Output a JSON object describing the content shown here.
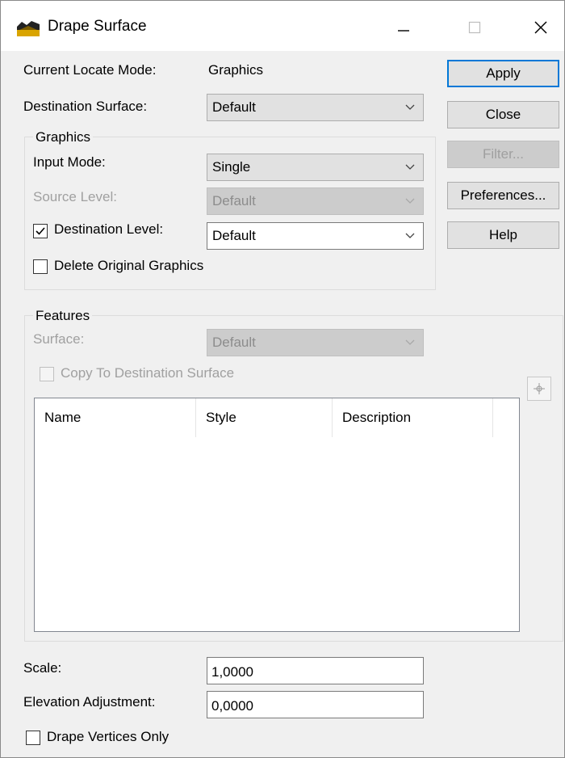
{
  "window": {
    "title": "Drape Surface",
    "icons": {
      "app": "drape-surface-app-icon",
      "minimize": "minimize-icon",
      "maximize": "maximize-icon",
      "close": "close-icon"
    }
  },
  "locate": {
    "label": "Current Locate Mode:",
    "value": "Graphics"
  },
  "destination_surface": {
    "label": "Destination Surface:",
    "value": "Default"
  },
  "buttons": {
    "apply": "Apply",
    "close": "Close",
    "filter": "Filter...",
    "preferences": "Preferences...",
    "help": "Help"
  },
  "graphics": {
    "legend": "Graphics",
    "input_mode": {
      "label": "Input Mode:",
      "value": "Single"
    },
    "source_level": {
      "label": "Source Level:",
      "value": "Default"
    },
    "destination_level": {
      "label": "Destination Level:",
      "value": "Default",
      "checked": true
    },
    "delete_original": {
      "label": "Delete Original Graphics",
      "checked": false
    }
  },
  "features": {
    "legend": "Features",
    "surface": {
      "label": "Surface:",
      "value": "Default"
    },
    "copy_to_destination": {
      "label": "Copy To Destination Surface",
      "checked": false
    },
    "table": {
      "columns": [
        "Name",
        "Style",
        "Description"
      ],
      "rows": []
    },
    "pick_icon": "crosshair-pick-icon"
  },
  "scale": {
    "label": "Scale:",
    "value": "1,0000"
  },
  "elevation": {
    "label": "Elevation Adjustment:",
    "value": "0,0000"
  },
  "drape_vertices": {
    "label": "Drape Vertices Only",
    "checked": false
  },
  "colors": {
    "accent": "#0078d7",
    "dialog_bg": "#f0f0f0",
    "disabled_text": "#a0a0a0"
  }
}
